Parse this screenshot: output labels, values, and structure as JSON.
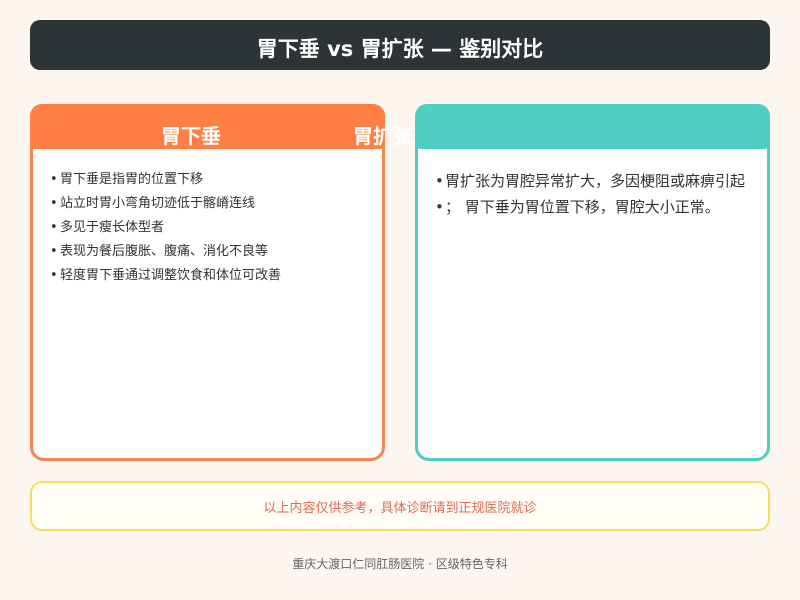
{
  "title": "胃下垂 vs 胃扩张 — 鉴别对比",
  "left_card": {
    "title": "胃下垂",
    "items": [
      "胃下垂是指胃的位置下移",
      "站立时胃小弯角切迹低于髂嵴连线",
      "多见于瘦长体型者",
      "表现为餐后腹胀、腹痛、消化不良等",
      "轻度胃下垂通过调整饮食和体位可改善"
    ]
  },
  "right_card": {
    "title": "胃扩张",
    "items": [
      "胃扩张为胃腔异常扩大，多因梗阻或麻痹引起",
      "；  胃下垂为胃位置下移，胃腔大小正常。"
    ]
  },
  "notice": "以上内容仅供参考，具体诊断请到正规医院就诊",
  "footer": "重庆大渡口仁同肛肠医院 · 区级特色专科",
  "colors": {
    "left_accent": "#ff7f45",
    "right_accent": "#4fcfc4",
    "title_bar": "#2d3436",
    "notice_border": "#f9dc5c",
    "notice_text": "#e26a53"
  }
}
